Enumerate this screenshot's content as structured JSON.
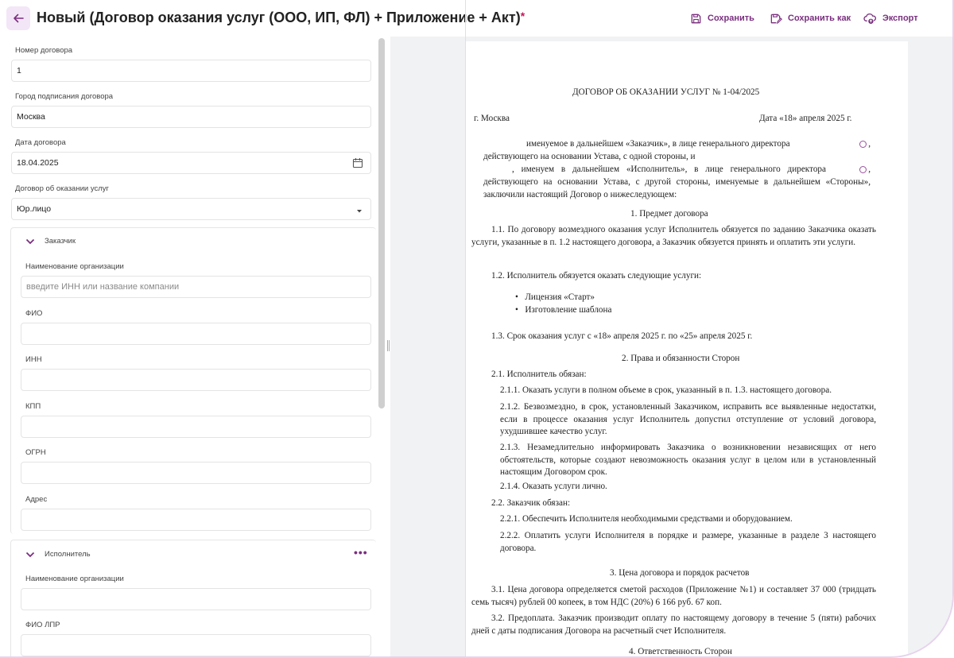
{
  "header": {
    "title": "Новый (Договор оказания услуг (ООО, ИП, ФЛ) + Приложение + Акт)",
    "unsaved_marker": "*",
    "save_label": "Сохранить",
    "save_as_label": "Сохранить как",
    "export_label": "Экспорт"
  },
  "form": {
    "contract_number": {
      "label": "Номер договора",
      "value": "1"
    },
    "city": {
      "label": "Город подписания договора",
      "value": "Москва"
    },
    "date": {
      "label": "Дата договора",
      "value": "18.04.2025"
    },
    "contract_type": {
      "label": "Договор об оказании услуг",
      "value": "Юр.лицо"
    },
    "customer": {
      "title": "Заказчик",
      "org_name": {
        "label": "Наименование организации",
        "placeholder": "введите ИНН или название компании"
      },
      "fio": {
        "label": "ФИО"
      },
      "inn": {
        "label": "ИНН"
      },
      "kpp": {
        "label": "КПП"
      },
      "ogrn": {
        "label": "ОГРН"
      },
      "address": {
        "label": "Адрес"
      }
    },
    "executor": {
      "title": "Исполнитель",
      "more": "•••",
      "org_name": {
        "label": "Наименование организации"
      },
      "fio_lpr": {
        "label": "ФИО ЛПР"
      }
    }
  },
  "document": {
    "heading": "ДОГОВОР ОБ ОКАЗАНИИ УСЛУГ № 1-04/2025",
    "city": "г. Москва",
    "date": "Дата «18» апреля 2025 г.",
    "intro1a": "именуемое в дальнейшем «Заказчик», в лице генерального директора",
    "intro1b": ",",
    "intro2": "действующего на основании Устава, с одной стороны, и",
    "intro3a": ", именуем в дальнейшем «Исполнитель», в лице генерального директора",
    "intro3b": ",",
    "intro4": "действующего на основании Устава, с другой стороны, именуемые в дальнейшем «Стороны», заключили настоящий Договор о нижеследующем:",
    "s1_title": "1.   Предмет договора",
    "p1_1": "1.1. По договору возмездного оказания услуг Исполнитель обязуется по заданию Заказчика оказать услуги, указанные в п. 1.2 настоящего договора, а Заказчик обязуется принять и оплатить эти услуги.",
    "p1_2": "1.2. Исполнитель обязуется оказать следующие услуги:",
    "services": [
      "Лицензия «Старт»",
      "Изготовление шаблона"
    ],
    "p1_3": "1.3. Срок оказания услуг с «18» апреля 2025 г. по «25» апреля 2025 г.",
    "s2_title": "2.   Права и обязанности Сторон",
    "p2_1": "2.1. Исполнитель обязан:",
    "p2_1_1": "2.1.1. Оказать услуги в полном объеме в срок, указанный в п. 1.3. настоящего договора.",
    "p2_1_2": "2.1.2. Безвозмездно, в срок, установленный Заказчиком, исправить все выявленные недостатки, если в процессе оказания услуг Исполнитель допустил отступление от условий договора, ухудшившее качество услуг.",
    "p2_1_3": "2.1.3. Незамедлительно информировать Заказчика о возникновении независящих от него обстоятельств, которые создают невозможность оказания услуг в целом или в установленный настоящим Договором срок.",
    "p2_1_4": "2.1.4. Оказать услуги лично.",
    "p2_2": "2.2. Заказчик обязан:",
    "p2_2_1": "2.2.1. Обеспечить Исполнителя необходимыми средствами и оборудованием.",
    "p2_2_2": "2.2.2. Оплатить услуги Исполнителя в порядке и размере, указанные в разделе 3 настоящего договора.",
    "s3_title": "3.   Цена договора и порядок расчетов",
    "p3_1": "3.1. Цена договора определяется сметой расходов (Приложение №1) и составляет 37 000 (тридцать семь тысяч) рублей 00 копеек, в том НДС (20%)  6 166 руб. 67 коп.",
    "p3_2": "3.2. Предоплата. Заказчик производит оплату по настоящему договору в течение 5 (пяти) рабочих дней с даты подписания Договора на расчетный счет Исполнителя.",
    "s4_title": "4.   Ответственность Сторон"
  },
  "colors": {
    "accent": "#7a2f7f",
    "back_bg": "#f3e6f6",
    "required": "#c2185b"
  }
}
